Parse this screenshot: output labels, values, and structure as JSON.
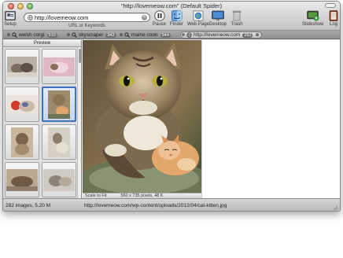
{
  "window": {
    "title": "\"http://lovemeow.com\" (Default Spider)"
  },
  "toolbar": {
    "setup_label": "Setup",
    "url_value": "http://lovemeow.com",
    "url_caption": "URL or Keywords",
    "pause_label": "Pause",
    "finder_label": "Finder",
    "webpage_label": "Web Page",
    "desktop_label": "Desktop",
    "trash_label": "Trash",
    "slideshow_label": "Slideshow",
    "log_label": "Log"
  },
  "tabs": [
    {
      "label": "welsh corgi",
      "count": "910"
    },
    {
      "label": "skyscraper",
      "count": "943"
    },
    {
      "label": "maine coon",
      "count": "944"
    },
    {
      "label": "http://lovemeow.com",
      "count": "282"
    }
  ],
  "sidebar": {
    "header": "Preview"
  },
  "image_status": {
    "scale_label": "Scale to Fit",
    "dimensions": "560 x 735 pixels, 48 K"
  },
  "statusbar": {
    "count": "282 images, 5.20 M",
    "path": "http://lovemeow.com/wp-content/uploads/2012/04/cat-kitten.jpg"
  },
  "colors": {
    "selection": "#3f6fbd",
    "toolbar_top": "#e9e9e9",
    "toolbar_bottom": "#c4c4c4"
  }
}
